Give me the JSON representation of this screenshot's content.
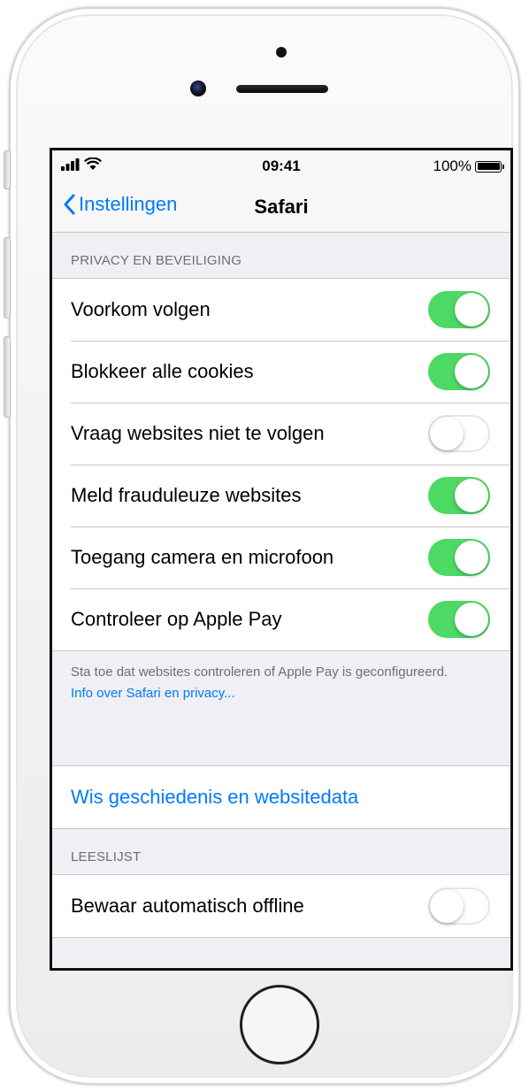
{
  "status_bar": {
    "time": "09:41",
    "battery_percent": "100%",
    "battery_level": 1.0
  },
  "nav": {
    "back_label": "Instellingen",
    "title": "Safari"
  },
  "privacy_section": {
    "header": "PRIVACY EN BEVEILIGING",
    "rows": [
      {
        "label": "Voorkom volgen",
        "on": true
      },
      {
        "label": "Blokkeer alle cookies",
        "on": true
      },
      {
        "label": "Vraag websites niet te volgen",
        "on": false
      },
      {
        "label": "Meld frauduleuze websites",
        "on": true
      },
      {
        "label": "Toegang camera en microfoon",
        "on": true
      },
      {
        "label": "Controleer op Apple Pay",
        "on": true
      }
    ],
    "footer_text": "Sta toe dat websites controleren of Apple Pay is geconfigureerd.",
    "footer_link": "Info over Safari en privacy..."
  },
  "clear_history": {
    "label": "Wis geschiedenis en websitedata"
  },
  "reading_list_section": {
    "header": "LEESLIJST",
    "rows": [
      {
        "label": "Bewaar automatisch offline",
        "on": false
      }
    ]
  },
  "colors": {
    "accent": "#007aff",
    "toggle_on": "#4cd964",
    "group_background": "#efeff4"
  },
  "icons": [
    "signal-bars-icon",
    "wifi-icon",
    "battery-icon",
    "chevron-left-icon",
    "home-button"
  ]
}
